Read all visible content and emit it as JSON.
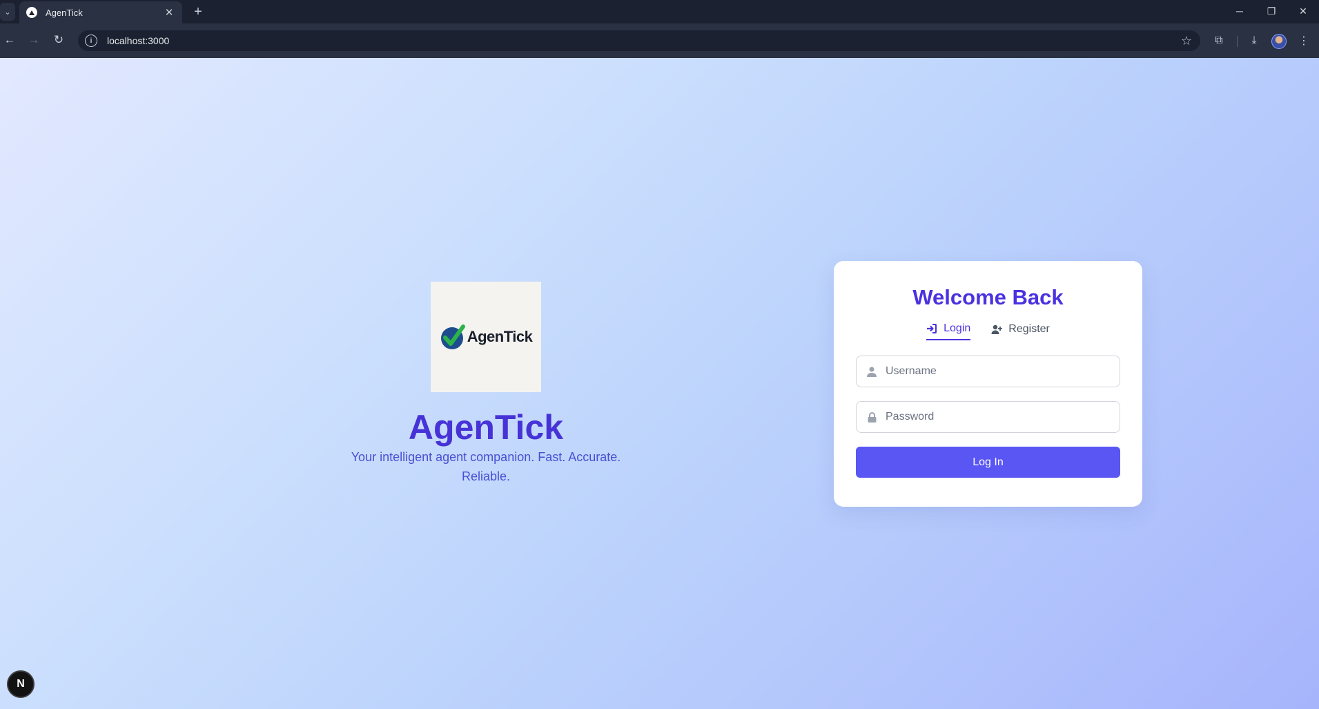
{
  "browser": {
    "tab_title": "AgenTick",
    "url": "localhost:3000",
    "new_tab_label": "+",
    "tab_close_label": "✕"
  },
  "brand": {
    "logo_wordmark": "AgenTick",
    "title": "AgenTick",
    "tagline": "Your intelligent agent companion. Fast. Accurate. Reliable."
  },
  "auth_card": {
    "title": "Welcome Back",
    "tabs": [
      {
        "label": "Login",
        "icon": "sign-in-icon",
        "active": true
      },
      {
        "label": "Register",
        "icon": "user-plus-icon",
        "active": false
      }
    ],
    "username_placeholder": "Username",
    "password_placeholder": "Password",
    "submit_label": "Log In"
  },
  "dev_badge": {
    "label": "N"
  },
  "colors": {
    "accent": "#4a32e0",
    "button": "#5a56f3",
    "brand_title": "#4632d6"
  }
}
